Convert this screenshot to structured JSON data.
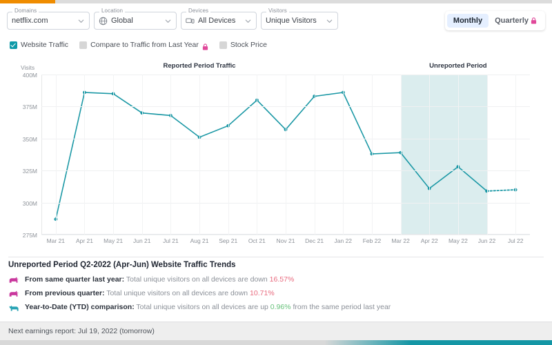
{
  "progress": {
    "percent": 10
  },
  "toolbar": {
    "fields": [
      {
        "legend": "Domains",
        "value": "netflix.com",
        "icon": "none"
      },
      {
        "legend": "Location",
        "value": "Global",
        "icon": "globe-icon"
      },
      {
        "legend": "Devices",
        "value": "All Devices",
        "icon": "devices-icon"
      },
      {
        "legend": "Visitors",
        "value": "Unique Visitors",
        "icon": "none"
      }
    ],
    "period_toggle": {
      "options": [
        {
          "label": "Monthly",
          "active": true,
          "locked": false
        },
        {
          "label": "Quarterly",
          "active": false,
          "locked": true
        }
      ]
    }
  },
  "legend": {
    "items": [
      {
        "label": "Website Traffic",
        "checked": true,
        "locked": false
      },
      {
        "label": "Compare to Traffic from Last Year",
        "checked": false,
        "locked": true
      },
      {
        "label": "Stock Price",
        "checked": false,
        "locked": false
      }
    ]
  },
  "chart_data": {
    "type": "line",
    "title": "",
    "xlabel": "",
    "ylabel": "Visits",
    "ylim": [
      275,
      400
    ],
    "yticks": [
      "400M",
      "375M",
      "350M",
      "325M",
      "300M",
      "275M"
    ],
    "ytick_values": [
      400,
      375,
      350,
      325,
      300,
      275
    ],
    "grid": true,
    "legend_position": "top",
    "categories": [
      "Mar 21",
      "Apr 21",
      "May 21",
      "Jun 21",
      "Jul 21",
      "Aug 21",
      "Sep 21",
      "Oct 21",
      "Nov 21",
      "Dec 21",
      "Jan 22",
      "Feb 22",
      "Mar 22",
      "Apr 22",
      "May 22",
      "Jun 22",
      "Jul 22"
    ],
    "series": [
      {
        "name": "Website Traffic",
        "color": "#1b98a5",
        "units": "millions of visits",
        "values": [
          287,
          386,
          385,
          370,
          368,
          351,
          360,
          380,
          357,
          383,
          386,
          338,
          339,
          311,
          328,
          309,
          310
        ]
      }
    ],
    "annotations": [
      {
        "label": "Reported Period Traffic",
        "index_center": 5
      },
      {
        "label": "Unreported Period",
        "index_center": 14
      }
    ],
    "shaded_region": {
      "from": "Mar 22",
      "to": "Jun 22",
      "color": "#cfe7e8"
    },
    "divider_at": "Mar 22",
    "dashed_from": "Jun 22",
    "dashed_to": "Jul 22"
  },
  "insights": {
    "title": "Unreported Period Q2-2022 (Apr-Jun) Website Traffic Trends",
    "rows": [
      {
        "icon": "bear-icon",
        "lead": "From same quarter last year:",
        "body_before": "Total unique visitors on all devices are down ",
        "pct": "16.57%",
        "direction": "down",
        "body_after": ""
      },
      {
        "icon": "bear-icon",
        "lead": "From previous quarter:",
        "body_before": "Total unique visitors on all devices are down ",
        "pct": "10.71%",
        "direction": "down",
        "body_after": ""
      },
      {
        "icon": "bull-icon",
        "lead": "Year-to-Date (YTD) comparison:",
        "body_before": "Total unique visitors on all devices are up ",
        "pct": "0.96%",
        "direction": "up",
        "body_after": " from the same period last year"
      }
    ]
  },
  "footer": {
    "text": "Next earnings report: Jul 19, 2022 (tomorrow)"
  },
  "colors": {
    "accent_orange": "#ef8c00",
    "series_teal": "#1b98a5",
    "band_teal": "#cfe7e8",
    "down_red": "#e8697d",
    "up_green": "#66c17a",
    "bear_pink": "#c9379d",
    "bull_teal": "#27a3b4",
    "lock_pink": "#e0489a"
  }
}
